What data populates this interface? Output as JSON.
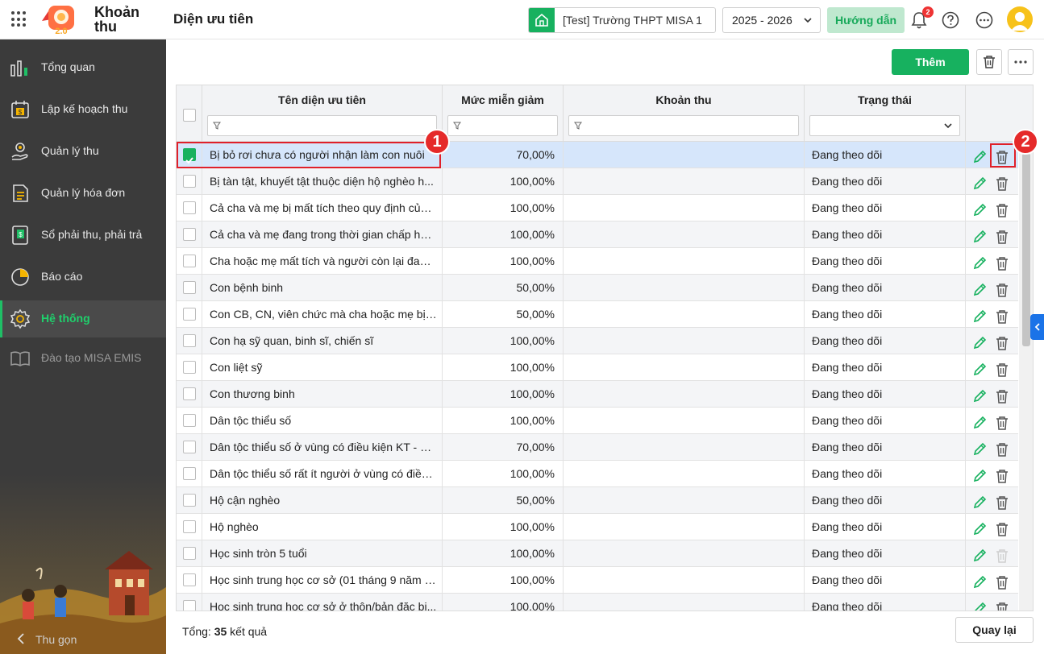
{
  "header": {
    "app_name_line1": "Khoản",
    "app_name_line2": "thu",
    "page_title": "Diện ưu tiên",
    "school": "[Test] Trường THPT MISA 1",
    "school_year": "2025 - 2026",
    "guide_label": "Hướng dẫn",
    "notification_count": "2",
    "logo_version": "2.0"
  },
  "sidebar": {
    "items": [
      {
        "label": "Tổng quan",
        "icon": "chart-bars-icon"
      },
      {
        "label": "Lập kế hoạch thu",
        "icon": "calendar-money-icon"
      },
      {
        "label": "Quản lý thu",
        "icon": "hand-coins-icon"
      },
      {
        "label": "Quản lý hóa đơn",
        "icon": "invoice-icon"
      },
      {
        "label": "Sổ phải thu, phải trả",
        "icon": "ledger-icon"
      },
      {
        "label": "Báo cáo",
        "icon": "pie-chart-icon"
      },
      {
        "label": "Hệ thống",
        "icon": "gear-icon"
      },
      {
        "label": "Đào tạo MISA EMIS",
        "icon": "book-open-icon"
      }
    ],
    "active_index": 6,
    "collapse_label": "Thu gọn"
  },
  "toolbar": {
    "add_label": "Thêm"
  },
  "table": {
    "columns": [
      "Tên diện ưu tiên",
      "Mức miễn giảm",
      "Khoản thu",
      "Trạng thái"
    ],
    "rows": [
      {
        "name": "Bị bỏ rơi chưa có người nhận làm con nuôi",
        "rate": "70,00%",
        "fee": "",
        "status": "Đang theo dõi",
        "checked": true,
        "deletable": true
      },
      {
        "name": "Bị tàn tật, khuyết tật thuộc diện hộ nghèo h...",
        "rate": "100,00%",
        "fee": "",
        "status": "Đang theo dõi",
        "checked": false,
        "deletable": true
      },
      {
        "name": "Cả cha và mẹ bị mất tích theo quy định của ...",
        "rate": "100,00%",
        "fee": "",
        "status": "Đang theo dõi",
        "checked": false,
        "deletable": true
      },
      {
        "name": "Cả cha và mẹ đang trong thời gian chấp hàn...",
        "rate": "100,00%",
        "fee": "",
        "status": "Đang theo dõi",
        "checked": false,
        "deletable": true
      },
      {
        "name": "Cha hoặc mẹ mất tích và người còn lại đang...",
        "rate": "100,00%",
        "fee": "",
        "status": "Đang theo dõi",
        "checked": false,
        "deletable": true
      },
      {
        "name": "Con bệnh binh",
        "rate": "50,00%",
        "fee": "",
        "status": "Đang theo dõi",
        "checked": false,
        "deletable": true
      },
      {
        "name": "Con CB, CN, viên chức mà cha hoặc mẹ bị t...",
        "rate": "50,00%",
        "fee": "",
        "status": "Đang theo dõi",
        "checked": false,
        "deletable": true
      },
      {
        "name": "Con hạ sỹ quan, binh sĩ, chiến sĩ",
        "rate": "100,00%",
        "fee": "",
        "status": "Đang theo dõi",
        "checked": false,
        "deletable": true
      },
      {
        "name": "Con liệt sỹ",
        "rate": "100,00%",
        "fee": "",
        "status": "Đang theo dõi",
        "checked": false,
        "deletable": true
      },
      {
        "name": "Con thương binh",
        "rate": "100,00%",
        "fee": "",
        "status": "Đang theo dõi",
        "checked": false,
        "deletable": true
      },
      {
        "name": "Dân tộc thiểu số",
        "rate": "100,00%",
        "fee": "",
        "status": "Đang theo dõi",
        "checked": false,
        "deletable": true
      },
      {
        "name": "Dân tộc thiểu số ở vùng có điều kiện KT - X...",
        "rate": "70,00%",
        "fee": "",
        "status": "Đang theo dõi",
        "checked": false,
        "deletable": true
      },
      {
        "name": "Dân tộc thiểu số rất ít người ở vùng có điều ...",
        "rate": "100,00%",
        "fee": "",
        "status": "Đang theo dõi",
        "checked": false,
        "deletable": true
      },
      {
        "name": "Hộ cận nghèo",
        "rate": "50,00%",
        "fee": "",
        "status": "Đang theo dõi",
        "checked": false,
        "deletable": true
      },
      {
        "name": "Hộ nghèo",
        "rate": "100,00%",
        "fee": "",
        "status": "Đang theo dõi",
        "checked": false,
        "deletable": true
      },
      {
        "name": "Học sinh tròn 5 tuổi",
        "rate": "100,00%",
        "fee": "",
        "status": "Đang theo dõi",
        "checked": false,
        "deletable": false
      },
      {
        "name": "Học sinh trung học cơ sở (01 tháng 9 năm 2...",
        "rate": "100,00%",
        "fee": "",
        "status": "Đang theo dõi",
        "checked": false,
        "deletable": true
      },
      {
        "name": "Học sinh trung học cơ sở ở thôn/bản đặc bi...",
        "rate": "100,00%",
        "fee": "",
        "status": "Đang theo dõi",
        "checked": false,
        "deletable": true
      }
    ]
  },
  "footer": {
    "total_prefix": "Tổng:",
    "total_count": "35",
    "total_suffix": "kết quả",
    "back_label": "Quay lại"
  },
  "annotations": {
    "badge1": "1",
    "badge2": "2"
  },
  "colors": {
    "brand_green": "#17b15f",
    "sidebar_bg": "#3b3b3b",
    "selected_row": "#d6e6fb",
    "annotation_red": "#e0202a"
  }
}
